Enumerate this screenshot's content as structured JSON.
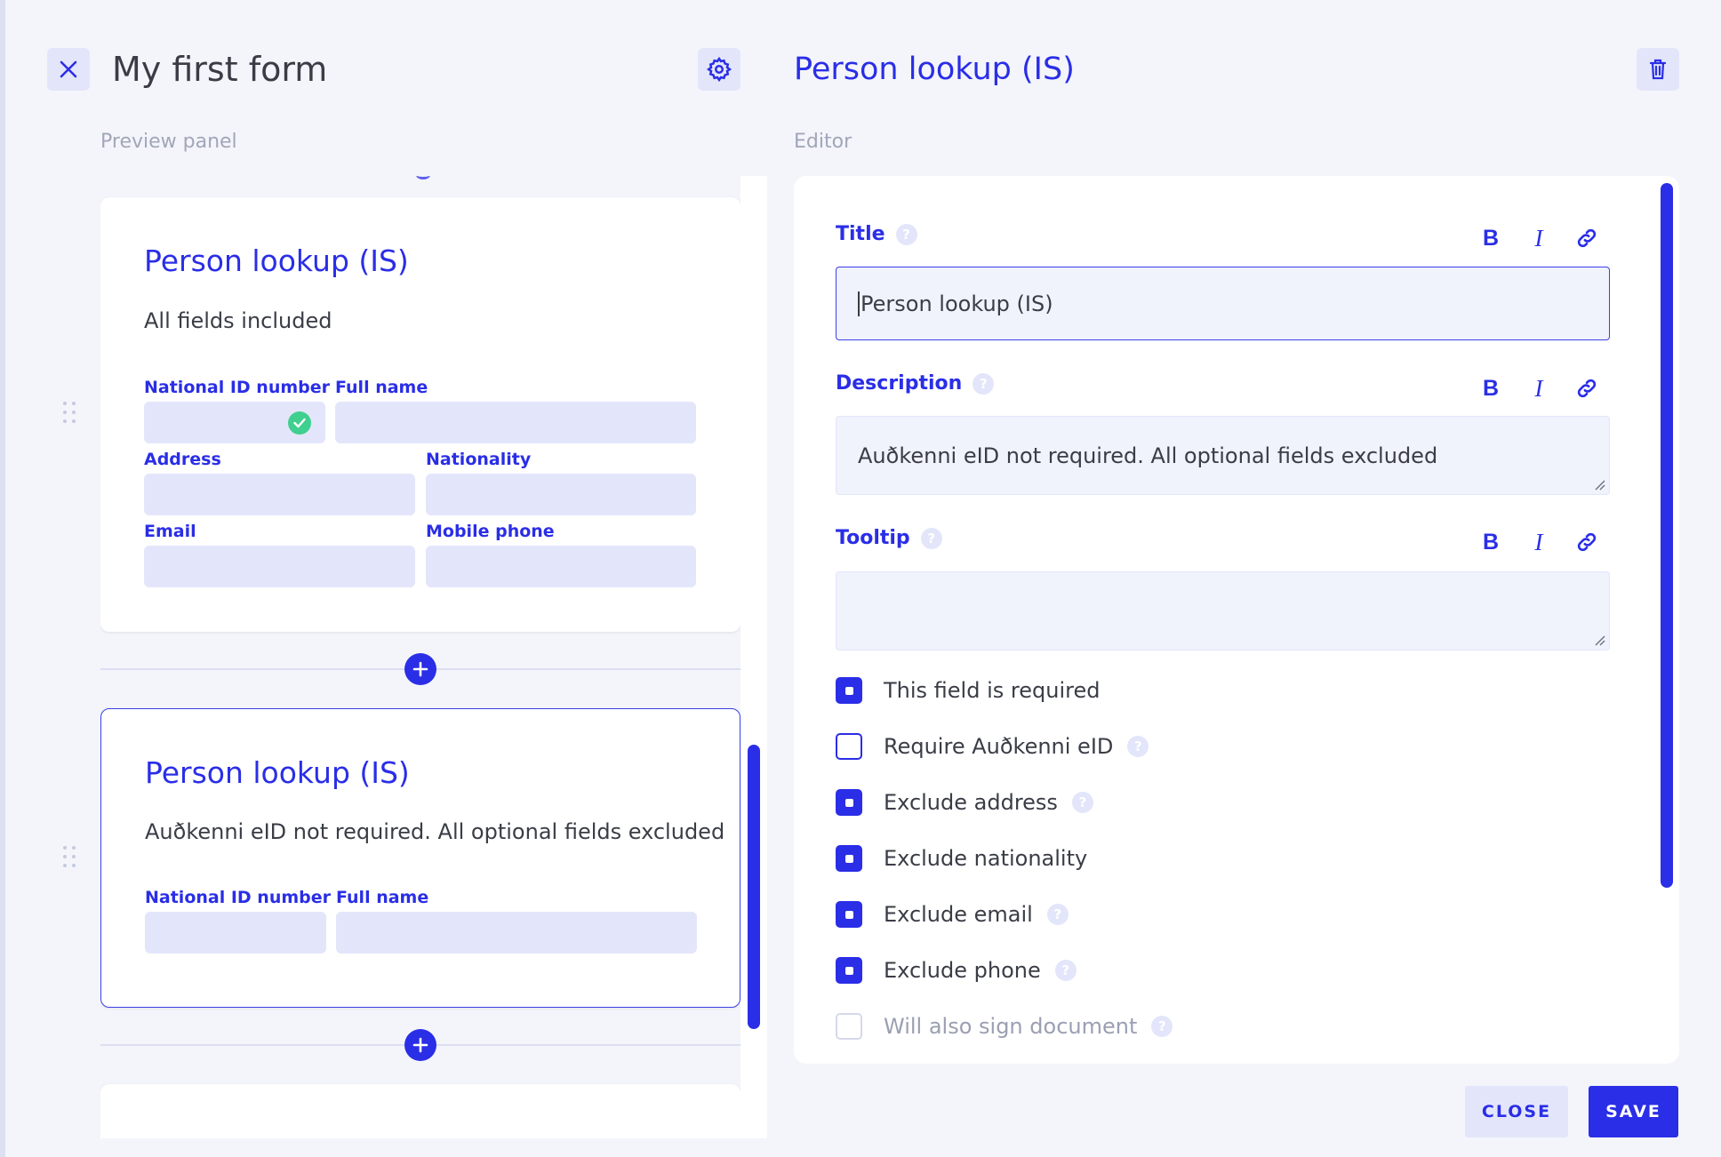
{
  "header": {
    "form_title": "My first form",
    "editor_title": "Person lookup (IS)",
    "close_icon": "close-icon",
    "settings_icon": "gear-icon",
    "delete_icon": "trash-icon"
  },
  "preview": {
    "label": "Preview panel",
    "cards": [
      {
        "title": "Person lookup (IS)",
        "description": "All fields included",
        "fields": {
          "national_id": "National ID number",
          "full_name": "Full name",
          "address": "Address",
          "nationality": "Nationality",
          "email": "Email",
          "mobile_phone": "Mobile phone"
        }
      },
      {
        "title": "Person lookup (IS)",
        "description": "Auðkenni eID not required. All optional fields excluded",
        "fields": {
          "national_id": "National ID number",
          "full_name": "Full name"
        }
      }
    ]
  },
  "editor": {
    "label": "Editor",
    "title_field": {
      "label": "Title",
      "value": "Person lookup (IS)"
    },
    "description_field": {
      "label": "Description",
      "value": "Auðkenni eID not required. All optional fields excluded"
    },
    "tooltip_field": {
      "label": "Tooltip",
      "value": ""
    },
    "format": {
      "bold": "B",
      "italic": "I"
    },
    "help": "?",
    "checkboxes": [
      {
        "label": "This field is required",
        "checked": true
      },
      {
        "label": "Require Auðkenni eID",
        "checked": false
      },
      {
        "label": "Exclude address",
        "checked": true
      },
      {
        "label": "Exclude nationality",
        "checked": true
      },
      {
        "label": "Exclude email",
        "checked": true
      },
      {
        "label": "Exclude phone",
        "checked": true
      },
      {
        "label": "Will also sign document",
        "checked": false
      }
    ]
  },
  "footer": {
    "close_label": "CLOSE",
    "save_label": "SAVE"
  },
  "colors": {
    "accent": "#2a2ee6",
    "field_bg": "#e3e6fa",
    "success": "#3fcf8e"
  }
}
